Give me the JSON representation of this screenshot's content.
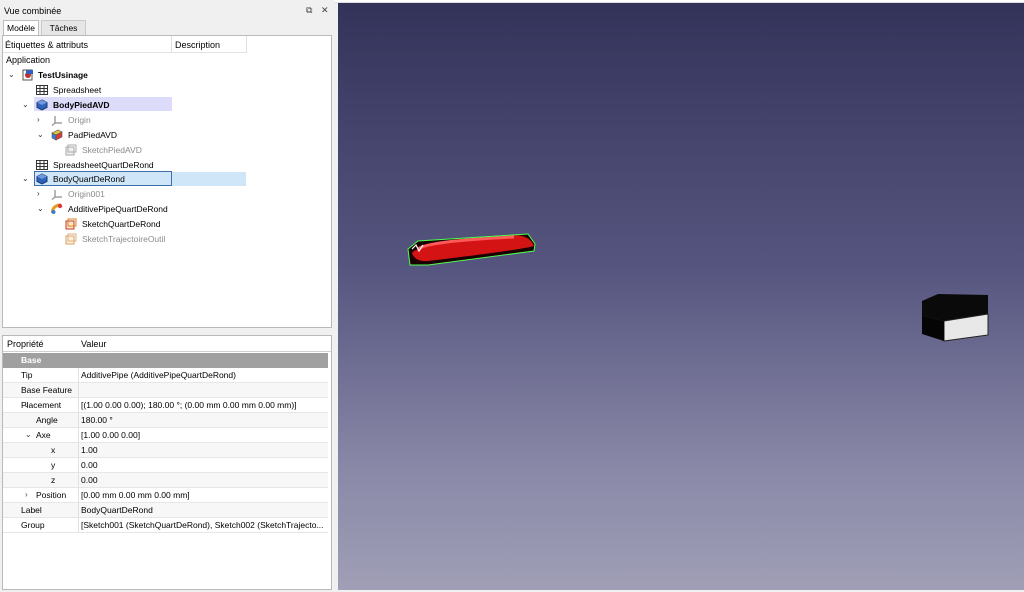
{
  "panel": {
    "title": "Vue combinée",
    "tabs": [
      {
        "label": "Modèle"
      },
      {
        "label": "Tâches"
      }
    ]
  },
  "tree": {
    "header_labels": "Étiquettes & attributs",
    "header_description": "Description",
    "root_label": "Application",
    "items": [
      {
        "label": "TestUsinage"
      },
      {
        "label": "Spreadsheet"
      },
      {
        "label": "BodyPiedAVD"
      },
      {
        "label": "Origin"
      },
      {
        "label": "PadPiedAVD"
      },
      {
        "label": "SketchPiedAVD"
      },
      {
        "label": "SpreadsheetQuartDeRond"
      },
      {
        "label": "BodyQuartDeRond"
      },
      {
        "label": "Origin001"
      },
      {
        "label": "AdditivePipeQuartDeRond"
      },
      {
        "label": "SketchQuartDeRond"
      },
      {
        "label": "SketchTrajectoireOutil"
      }
    ]
  },
  "properties": {
    "col_property": "Propriété",
    "col_value": "Valeur",
    "group": "Base",
    "rows": [
      {
        "name": "Tip",
        "value": "AdditivePipe (AdditivePipeQuartDeRond)"
      },
      {
        "name": "Base Feature",
        "value": ""
      },
      {
        "name": "Placement",
        "value": "[(1.00 0.00 0.00); 180.00 °; (0.00 mm  0.00 mm  0.00 mm)]"
      },
      {
        "name": "Angle",
        "value": "180.00 °"
      },
      {
        "name": "Axe",
        "value": "[1.00 0.00 0.00]"
      },
      {
        "name": "x",
        "value": "1.00"
      },
      {
        "name": "y",
        "value": "0.00"
      },
      {
        "name": "z",
        "value": "0.00"
      },
      {
        "name": "Position",
        "value": "[0.00 mm  0.00 mm  0.00 mm]"
      },
      {
        "name": "Label",
        "value": "BodyQuartDeRond"
      },
      {
        "name": "Group",
        "value": "[Sketch001 (SketchQuartDeRond), Sketch002 (SketchTrajecto..."
      }
    ]
  }
}
